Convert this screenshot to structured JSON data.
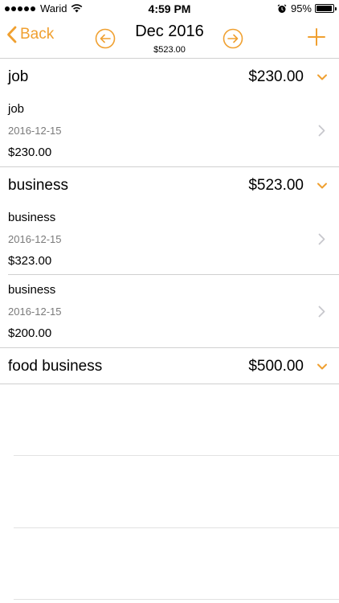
{
  "status_bar": {
    "carrier": "Warid",
    "time": "4:59 PM",
    "battery": "95%",
    "battery_level": 0.95,
    "signal_bars_filled": 5
  },
  "nav": {
    "back_label": "Back",
    "title": "Dec 2016",
    "subtitle": "$523.00",
    "prev_icon": "arrow-left-circle-icon",
    "next_icon": "arrow-right-circle-icon",
    "add_icon": "plus-icon"
  },
  "colors": {
    "accent": "#f0a030",
    "divider": "#d0d0d0",
    "secondary_text": "#7a7a7a",
    "chevron_gray": "#c7c7cc"
  },
  "sections": [
    {
      "name": "job",
      "total": "$230.00",
      "entries": [
        {
          "name": "job",
          "date": "2016-12-15",
          "amount": "$230.00"
        }
      ]
    },
    {
      "name": "business",
      "total": "$523.00",
      "entries": [
        {
          "name": "business",
          "date": "2016-12-15",
          "amount": "$323.00"
        },
        {
          "name": "business",
          "date": "2016-12-15",
          "amount": "$200.00"
        }
      ]
    },
    {
      "name": "food business",
      "total": "$500.00",
      "entries": []
    }
  ]
}
